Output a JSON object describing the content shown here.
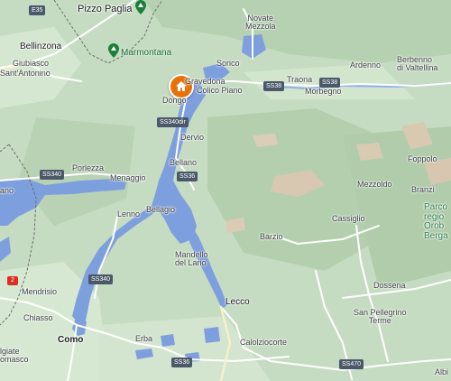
{
  "places": {
    "pizzo_paglia": "Pizzo Paglia",
    "marmontana": "Marmontana",
    "bellinzona": "Bellinzona",
    "giubiasco": "Giubiasco",
    "santantonino": "Sant'Antonino",
    "novate_mezzola": "Novate\nMezzola",
    "sorico": "Sorico",
    "gravedona": "Gravedona",
    "dongo": "Dongo",
    "colico_piano": "Colico Piano",
    "traona": "Traona",
    "morbegno": "Morbegno",
    "ardenno": "Ardenno",
    "berbenno": "Berbenno\ndi Valtellina",
    "dervio": "Dervio",
    "bellano": "Bellano",
    "porlezza": "Porlezza",
    "menaggio": "Menaggio",
    "lenno": "Lenno",
    "bellagio": "Bellagio",
    "lugano": "ano",
    "mandello": "Mandello\ndel Lario",
    "barzio": "Barzio",
    "lecco": "Lecco",
    "calolziocorte": "Calolziocorte",
    "mendrisio": "Mendrisio",
    "chiasso": "Chiasso",
    "como": "Como",
    "erba": "Erba",
    "olgiate": "lgiate\nomasco",
    "foppolo": "Foppolo",
    "mezzoldo": "Mezzoldo",
    "branzi": "Branzi",
    "cassiglio": "Cassiglio",
    "parco": "Parco\nregio\nOrob\nBerga",
    "dossena": "Dossena",
    "san_pellegrino": "San Pellegrino\nTerme",
    "albino": "Albi"
  },
  "roads": {
    "e35": "E35",
    "ss38a": "SS38",
    "ss38b": "SS38",
    "ss340dir": "SS340dir",
    "ss36a": "SS36",
    "ss340a": "SS340",
    "ss340b": "SS340",
    "ss36b": "SS36",
    "ss470": "SS470",
    "route2": "2"
  },
  "colors": {
    "terrain": "#c9ddc5",
    "lake": "#7e9fde",
    "road": "#ffffff",
    "border": "#6b6b6b",
    "home_pin": "#e8710a",
    "park_pin": "#188038"
  },
  "icons": {
    "home": "home-icon",
    "park": "park-icon"
  }
}
